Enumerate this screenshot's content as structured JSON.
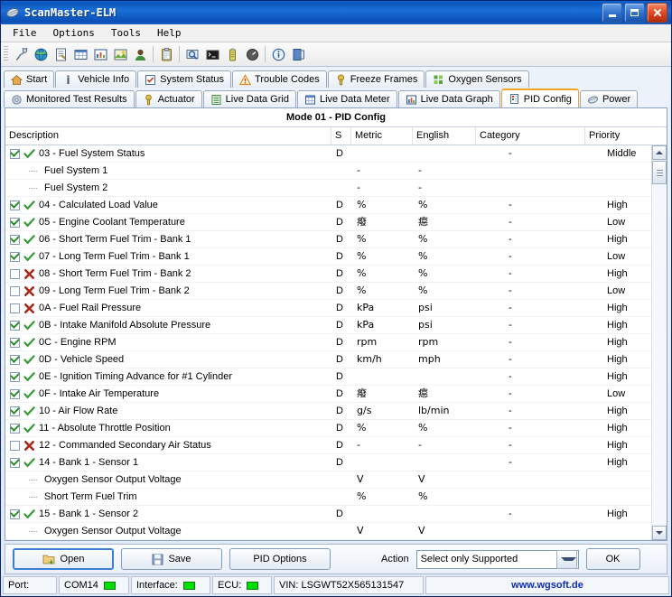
{
  "window": {
    "title": "ScanMaster-ELM",
    "icon": "chip-icon",
    "controls": {
      "minimize": "Minimize",
      "maximize": "Maximize",
      "close": "Close"
    }
  },
  "menu": {
    "items": [
      "File",
      "Options",
      "Tools",
      "Help"
    ]
  },
  "toolbar": {
    "buttons": [
      "connect-icon",
      "globe-icon",
      "report-icon",
      "grid-icon",
      "chart-icon",
      "image-icon",
      "user-icon",
      "clipboard-icon",
      "search-window-icon",
      "terminal-icon",
      "battery-icon",
      "gauge-icon",
      "info-icon",
      "exit-icon"
    ]
  },
  "tabs": {
    "row1": [
      {
        "label": "Start",
        "icon": "home-icon",
        "active": false
      },
      {
        "label": "Vehicle Info",
        "icon": "info-i-icon",
        "active": false
      },
      {
        "label": "System Status",
        "icon": "checklist-icon",
        "active": false
      },
      {
        "label": "Trouble Codes",
        "icon": "warning-icon",
        "active": false
      },
      {
        "label": "Freeze Frames",
        "icon": "snowflake-icon",
        "active": false
      },
      {
        "label": "Oxygen Sensors",
        "icon": "sensor-grid-icon",
        "active": false
      }
    ],
    "row2": [
      {
        "label": "Monitored Test Results",
        "icon": "gear-icon",
        "active": false
      },
      {
        "label": "Actuator",
        "icon": "actuator-icon",
        "active": false
      },
      {
        "label": "Live Data Grid",
        "icon": "list-icon",
        "active": false
      },
      {
        "label": "Live Data Meter",
        "icon": "meter-icon",
        "active": false
      },
      {
        "label": "Live Data Graph",
        "icon": "bar-chart-icon",
        "active": false
      },
      {
        "label": "PID Config",
        "icon": "pid-icon",
        "active": true
      },
      {
        "label": "Power",
        "icon": "chip-icon",
        "active": false
      }
    ]
  },
  "panel": {
    "title": "Mode 01 - PID Config",
    "columns": [
      "Description",
      "S",
      "Metric",
      "English",
      "Category",
      "Priority"
    ],
    "rows": [
      {
        "type": "pid",
        "checked": true,
        "status": "ok",
        "description": "03 - Fuel System Status",
        "s": "D",
        "metric": "",
        "english": "",
        "category": "-",
        "priority": "Middle"
      },
      {
        "type": "sub",
        "description": "Fuel System 1",
        "s": "",
        "metric": "-",
        "english": "-",
        "category": "",
        "priority": ""
      },
      {
        "type": "sub",
        "description": "Fuel System 2",
        "s": "",
        "metric": "-",
        "english": "-",
        "category": "",
        "priority": ""
      },
      {
        "type": "pid",
        "checked": true,
        "status": "ok",
        "description": "04 - Calculated Load Value",
        "s": "D",
        "metric": "%",
        "english": "%",
        "category": "-",
        "priority": "High"
      },
      {
        "type": "pid",
        "checked": true,
        "status": "ok",
        "description": "05 - Engine Coolant Temperature",
        "s": "D",
        "metric": "癈",
        "english": "癋",
        "category": "-",
        "priority": "Low"
      },
      {
        "type": "pid",
        "checked": true,
        "status": "ok",
        "description": "06 - Short Term Fuel Trim - Bank 1",
        "s": "D",
        "metric": "%",
        "english": "%",
        "category": "-",
        "priority": "High"
      },
      {
        "type": "pid",
        "checked": true,
        "status": "ok",
        "description": "07 - Long Term Fuel Trim - Bank 1",
        "s": "D",
        "metric": "%",
        "english": "%",
        "category": "-",
        "priority": "Low"
      },
      {
        "type": "pid",
        "checked": false,
        "status": "fail",
        "description": "08 - Short Term Fuel Trim - Bank 2",
        "s": "D",
        "metric": "%",
        "english": "%",
        "category": "-",
        "priority": "High"
      },
      {
        "type": "pid",
        "checked": false,
        "status": "fail",
        "description": "09 - Long Term Fuel Trim - Bank 2",
        "s": "D",
        "metric": "%",
        "english": "%",
        "category": "-",
        "priority": "Low"
      },
      {
        "type": "pid",
        "checked": false,
        "status": "fail",
        "description": "0A - Fuel Rail Pressure",
        "s": "D",
        "metric": "kPa",
        "english": "psi",
        "category": "-",
        "priority": "High"
      },
      {
        "type": "pid",
        "checked": true,
        "status": "ok",
        "description": "0B - Intake Manifold Absolute Pressure",
        "s": "D",
        "metric": "kPa",
        "english": "psi",
        "category": "-",
        "priority": "High"
      },
      {
        "type": "pid",
        "checked": true,
        "status": "ok",
        "description": "0C - Engine RPM",
        "s": "D",
        "metric": "rpm",
        "english": "rpm",
        "category": "-",
        "priority": "High"
      },
      {
        "type": "pid",
        "checked": true,
        "status": "ok",
        "description": "0D - Vehicle Speed",
        "s": "D",
        "metric": "km/h",
        "english": "mph",
        "category": "-",
        "priority": "High"
      },
      {
        "type": "pid",
        "checked": true,
        "status": "ok",
        "description": "0E - Ignition Timing Advance for #1 Cylinder",
        "s": "D",
        "metric": "",
        "english": "",
        "category": "-",
        "priority": "High"
      },
      {
        "type": "pid",
        "checked": true,
        "status": "ok",
        "description": "0F - Intake Air Temperature",
        "s": "D",
        "metric": "癈",
        "english": "癋",
        "category": "-",
        "priority": "Low"
      },
      {
        "type": "pid",
        "checked": true,
        "status": "ok",
        "description": "10 - Air Flow Rate",
        "s": "D",
        "metric": "g/s",
        "english": "lb/min",
        "category": "-",
        "priority": "High"
      },
      {
        "type": "pid",
        "checked": true,
        "status": "ok",
        "description": "11 - Absolute Throttle Position",
        "s": "D",
        "metric": "%",
        "english": "%",
        "category": "-",
        "priority": "High"
      },
      {
        "type": "pid",
        "checked": false,
        "status": "fail",
        "description": "12 - Commanded Secondary Air Status",
        "s": "D",
        "metric": "-",
        "english": "-",
        "category": "-",
        "priority": "High"
      },
      {
        "type": "pid",
        "checked": true,
        "status": "ok",
        "description": "14 - Bank 1 - Sensor 1",
        "s": "D",
        "metric": "",
        "english": "",
        "category": "-",
        "priority": "High"
      },
      {
        "type": "sub",
        "description": "Oxygen Sensor Output Voltage",
        "s": "",
        "metric": "V",
        "english": "V",
        "category": "",
        "priority": ""
      },
      {
        "type": "sub",
        "description": "Short Term Fuel Trim",
        "s": "",
        "metric": "%",
        "english": "%",
        "category": "",
        "priority": ""
      },
      {
        "type": "pid",
        "checked": true,
        "status": "ok",
        "description": "15 - Bank 1 - Sensor 2",
        "s": "D",
        "metric": "",
        "english": "",
        "category": "-",
        "priority": "High"
      },
      {
        "type": "sub",
        "description": "Oxygen Sensor Output Voltage",
        "s": "",
        "metric": "V",
        "english": "V",
        "category": "",
        "priority": ""
      }
    ]
  },
  "actionbar": {
    "open_label": "Open",
    "save_label": "Save",
    "pid_options_label": "PID Options",
    "action_label": "Action",
    "action_value": "Select only Supported",
    "ok_label": "OK"
  },
  "statusbar": {
    "port_label": "Port:",
    "port_value": "COM14",
    "interface_label": "Interface:",
    "ecu_label": "ECU:",
    "vin": "VIN: LSGWT52X565131547",
    "website": "www.wgsoft.de",
    "led_color": "#00e000"
  }
}
